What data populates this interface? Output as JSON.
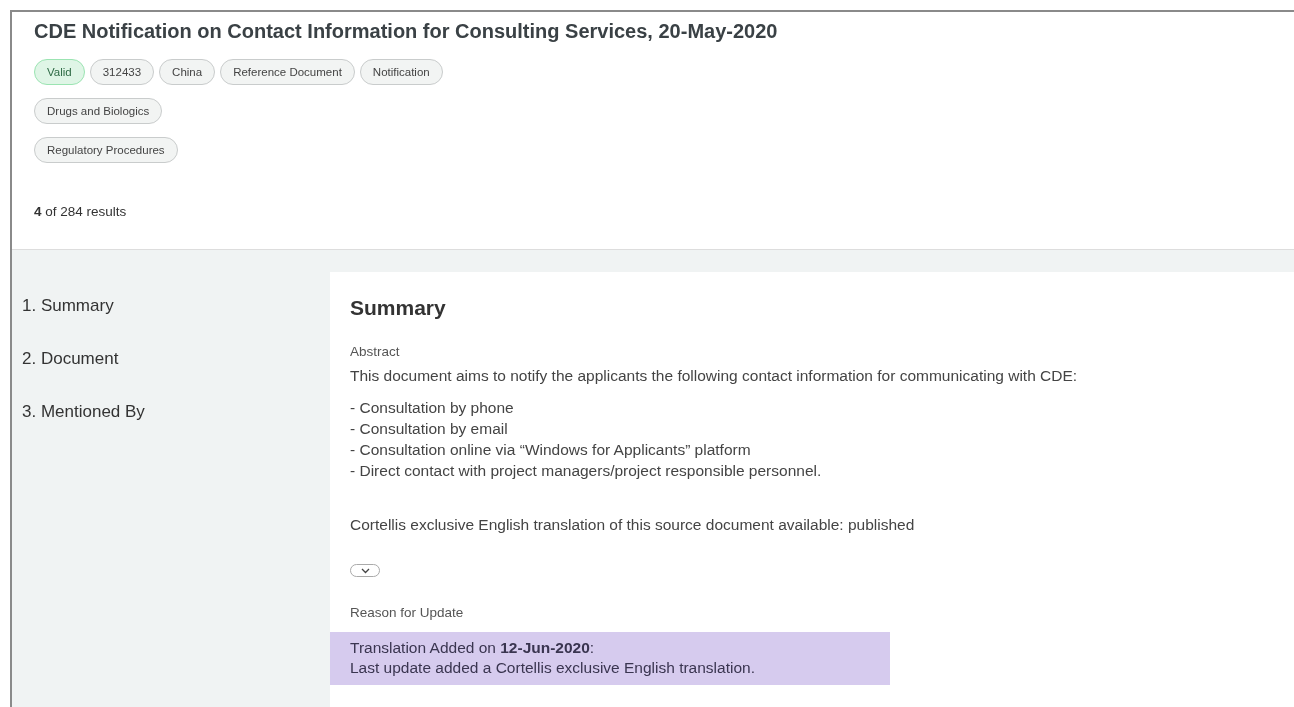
{
  "title": "CDE Notification on Contact Information for Consulting Services, 20-May-2020",
  "tag_rows": [
    [
      {
        "label": "Valid",
        "kind": "status"
      },
      {
        "label": "312433",
        "kind": "tag"
      },
      {
        "label": "China",
        "kind": "tag"
      },
      {
        "label": "Reference Document",
        "kind": "tag"
      },
      {
        "label": "Notification",
        "kind": "tag"
      }
    ],
    [
      {
        "label": "Drugs and Biologics",
        "kind": "tag"
      }
    ],
    [
      {
        "label": "Regulatory Procedures",
        "kind": "tag"
      }
    ]
  ],
  "results": "**4** of 284 results",
  "sidebar": {
    "items": [
      {
        "label": "1. Summary"
      },
      {
        "label": "2. Document"
      },
      {
        "label": "3. Mentioned By"
      }
    ]
  },
  "summary": {
    "heading": "Summary",
    "abstract_label": "Abstract",
    "abstract": "This document aims to notify the applicants the following contact information for communicating with CDE:",
    "list": [
      "- Consultation by phone",
      "- Consultation by email",
      "- Consultation online via “Windows for Applicants” platform",
      "- Direct contact with project managers/project responsible personnel."
    ],
    "translation_note": "Cortellis exclusive English translation of this source document available: published",
    "reason_label": "Reason for Update",
    "reason_lines": [
      "Translation Added on **12-Jun-2020**:",
      "Last update added a Cortellis exclusive English translation."
    ]
  }
}
